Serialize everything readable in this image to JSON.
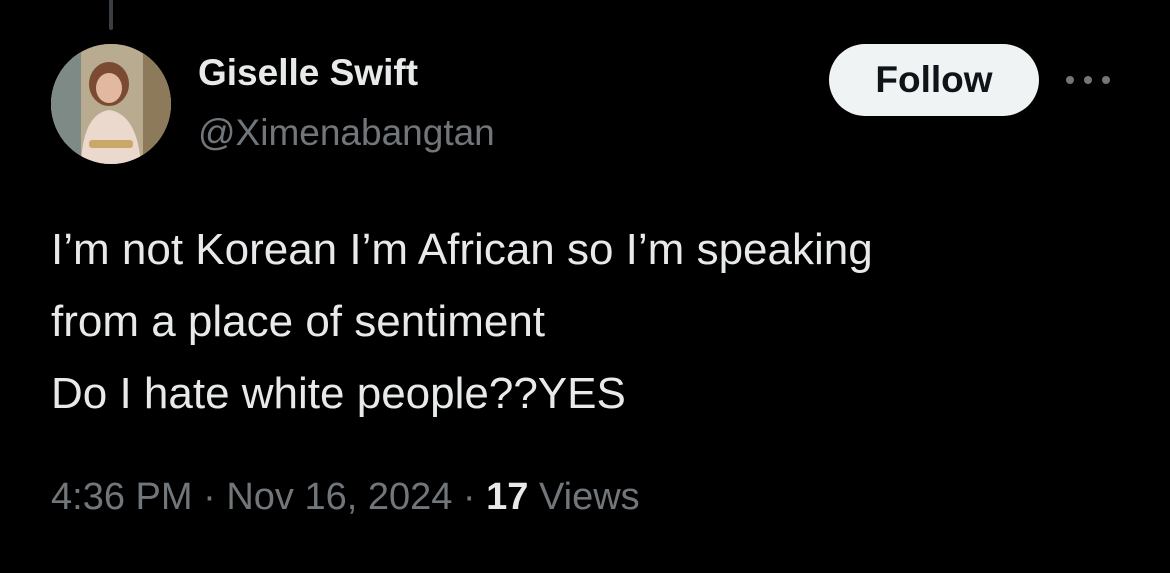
{
  "author": {
    "display_name": "Giselle Swift",
    "handle": "@Ximenabangtan",
    "avatar_icon": "profile-photo"
  },
  "actions": {
    "follow_label": "Follow",
    "more_icon": "more-horizontal-icon"
  },
  "tweet": {
    "lines": [
      "I’m not Korean I’m African so I’m speaking",
      "from a place of sentiment",
      "Do I hate white people??YES"
    ]
  },
  "meta": {
    "time": "4:36 PM",
    "separator": " · ",
    "date": "Nov 16, 2024",
    "views_count": "17",
    "views_label": " Views"
  },
  "colors": {
    "background": "#000000",
    "primary_text": "#e7e9ea",
    "secondary_text": "#71767b",
    "follow_button_bg": "#eff3f4"
  }
}
